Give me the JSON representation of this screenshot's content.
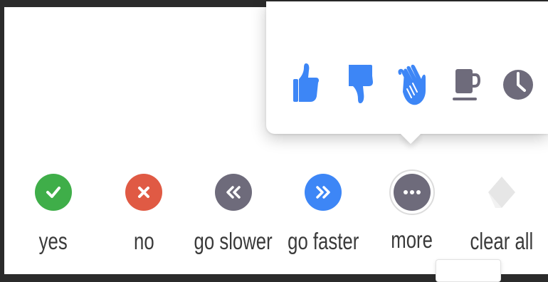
{
  "reactions": [
    {
      "name": "thumbs-up",
      "color": "#3d86f6"
    },
    {
      "name": "thumbs-down",
      "color": "#3d86f6"
    },
    {
      "name": "clapping-hands",
      "color": "#3d86f6"
    },
    {
      "name": "coffee-cup",
      "color": "#6e6b7b"
    },
    {
      "name": "clock",
      "color": "#6e6b7b"
    }
  ],
  "buttons": {
    "yes": {
      "label": "yes",
      "icon": "checkmark-icon",
      "color": "#3fae49"
    },
    "no": {
      "label": "no",
      "icon": "cross-icon",
      "color": "#e05a44"
    },
    "go_slower": {
      "label": "go slower",
      "icon": "double-chevron-left-icon",
      "color": "#6e6b7b"
    },
    "go_faster": {
      "label": "go faster",
      "icon": "double-chevron-right-icon",
      "color": "#3d86f6"
    },
    "more": {
      "label": "more",
      "icon": "ellipsis-icon",
      "color": "#6e6b7b"
    },
    "clear_all": {
      "label": "clear all",
      "icon": "eraser-icon",
      "color": "#e6e6e6"
    }
  }
}
